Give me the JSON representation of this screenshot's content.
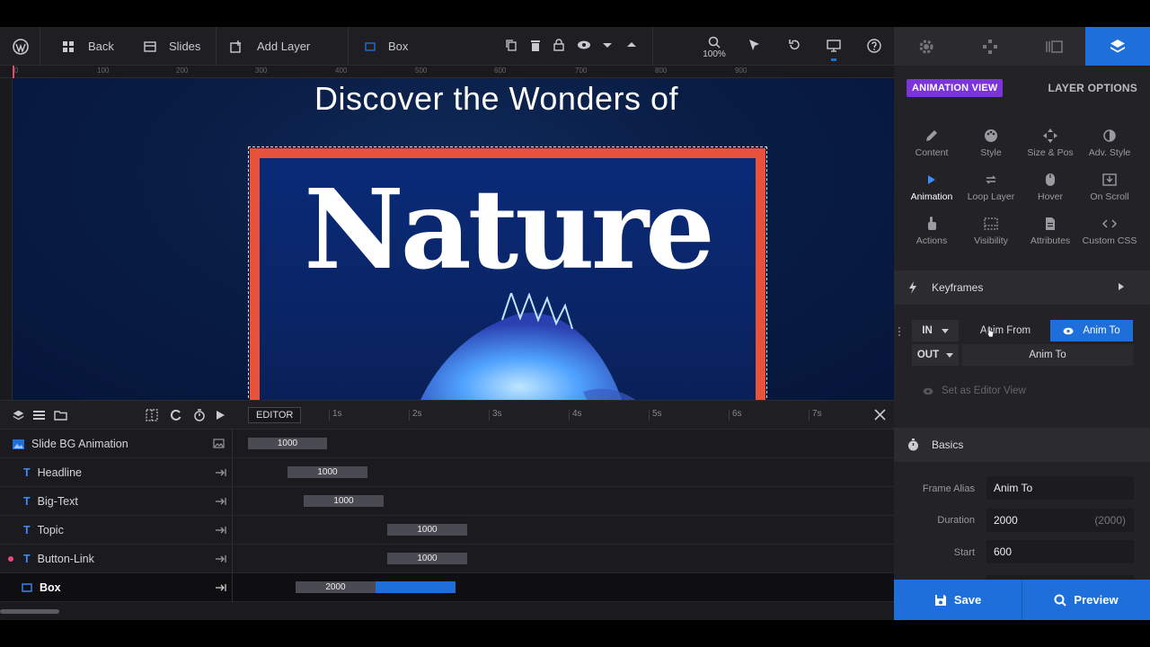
{
  "toolbar": {
    "back_label": "Back",
    "slides_label": "Slides",
    "add_layer_label": "Add Layer",
    "box_label": "Box",
    "zoom": "100%"
  },
  "ruler": {
    "top_ticks": [
      "0",
      "100",
      "200",
      "300",
      "400",
      "500",
      "600",
      "700",
      "800",
      "900"
    ]
  },
  "canvas": {
    "headline": "Discover the Wonders of",
    "bigtext": "Nature"
  },
  "timeline": {
    "editor_label": "EDITOR",
    "seconds": [
      "1s",
      "2s",
      "3s",
      "4s",
      "5s",
      "6s",
      "7s"
    ],
    "rows": [
      {
        "name": "Slide BG Animation",
        "bar": "1000"
      },
      {
        "name": "Headline",
        "bar": "1000"
      },
      {
        "name": "Big-Text",
        "bar": "1000"
      },
      {
        "name": "Topic",
        "bar": "1000"
      },
      {
        "name": "Button-Link",
        "bar": "1000"
      },
      {
        "name": "Box",
        "bar": "2000"
      }
    ]
  },
  "panel": {
    "animation_view": "ANIMATION VIEW",
    "layer_options": "LAYER OPTIONS",
    "options": [
      "Content",
      "Style",
      "Size & Pos",
      "Adv. Style",
      "Animation",
      "Loop Layer",
      "Hover",
      "On Scroll",
      "Actions",
      "Visibility",
      "Attributes",
      "Custom CSS"
    ],
    "keyframes_title": "Keyframes",
    "in_label": "IN",
    "out_label": "OUT",
    "anim_from": "Anim From",
    "anim_to": "Anim To",
    "anim_to_out": "Anim To",
    "set_editor_view": "Set as Editor View",
    "basics_title": "Basics",
    "fields": {
      "frame_alias_label": "Frame Alias",
      "frame_alias_value": "Anim To",
      "duration_label": "Duration",
      "duration_value": "2000",
      "duration_hint": "(2000)",
      "start_label": "Start",
      "start_value": "600"
    }
  },
  "footer": {
    "save_label": "Save",
    "preview_label": "Preview"
  },
  "colors": {
    "accent": "#1e6fd9",
    "badge": "#7b34d9",
    "box_border": "#e8523a",
    "canvas_bg": "#091d44"
  }
}
